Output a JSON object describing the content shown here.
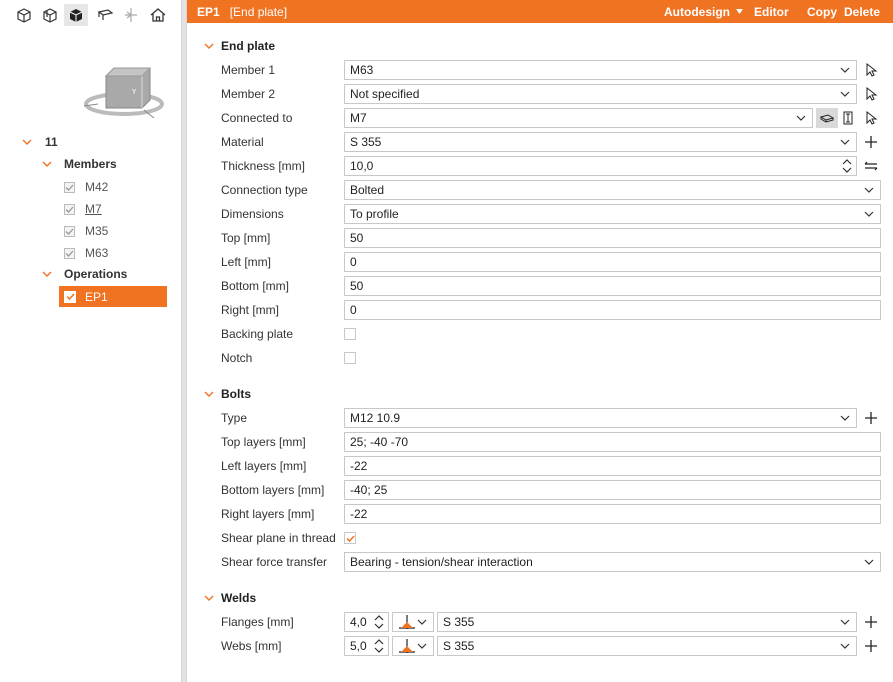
{
  "header": {
    "id": "EP1",
    "name": "[End plate]",
    "autodesign": "Autodesign",
    "editor": "Editor",
    "copy": "Copy",
    "delete": "Delete"
  },
  "tree": {
    "root": "11",
    "members_label": "Members",
    "members": [
      "M42",
      "M7",
      "M35",
      "M63"
    ],
    "operations_label": "Operations",
    "operations": [
      "EP1"
    ]
  },
  "end_plate": {
    "title": "End plate",
    "member1_label": "Member 1",
    "member1": "M63",
    "member2_label": "Member 2",
    "member2": "Not specified",
    "connected_label": "Connected to",
    "connected": "M7",
    "material_label": "Material",
    "material": "S 355",
    "thickness_label": "Thickness [mm]",
    "thickness": "10,0",
    "conn_type_label": "Connection type",
    "conn_type": "Bolted",
    "dimensions_label": "Dimensions",
    "dimensions": "To profile",
    "top_label": "Top [mm]",
    "top": "50",
    "left_label": "Left [mm]",
    "left": "0",
    "bottom_label": "Bottom [mm]",
    "bottom": "50",
    "right_label": "Right [mm]",
    "right": "0",
    "backing_label": "Backing plate",
    "backing": false,
    "notch_label": "Notch",
    "notch": false
  },
  "bolts": {
    "title": "Bolts",
    "type_label": "Type",
    "type": "M12 10.9",
    "top_layers_label": "Top layers [mm]",
    "top_layers": "25; -40 -70",
    "left_layers_label": "Left layers [mm]",
    "left_layers": "-22",
    "bottom_layers_label": "Bottom layers [mm]",
    "bottom_layers": "-40; 25",
    "right_layers_label": "Right layers [mm]",
    "right_layers": "-22",
    "shear_plane_label": "Shear plane in thread",
    "shear_plane": true,
    "shear_force_label": "Shear force transfer",
    "shear_force": "Bearing - tension/shear interaction"
  },
  "welds": {
    "title": "Welds",
    "flanges_label": "Flanges [mm]",
    "flanges": "4,0",
    "flanges_material": "S 355",
    "webs_label": "Webs [mm]",
    "webs": "5,0",
    "webs_material": "S 355"
  },
  "colors": {
    "accent": "#f07322"
  }
}
